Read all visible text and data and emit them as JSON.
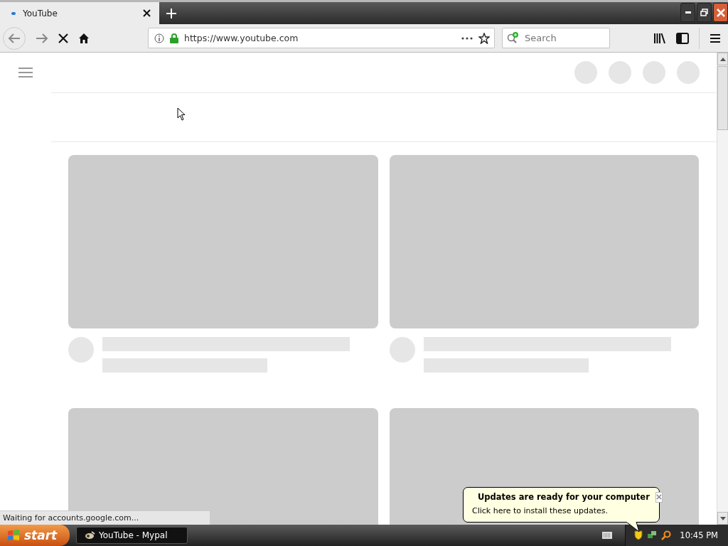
{
  "browser": {
    "tabs": [
      {
        "title": "YouTube",
        "selected": true
      }
    ],
    "address": "https://www.youtube.com",
    "search": {
      "placeholder": "Search"
    },
    "status": "Waiting for accounts.google.com..."
  },
  "page": {
    "cards": [
      {
        "kind": "skeleton"
      },
      {
        "kind": "skeleton"
      },
      {
        "kind": "thumbnail_only"
      },
      {
        "kind": "thumbnail_only"
      }
    ]
  },
  "taskbar": {
    "start": "start",
    "tasks": [
      {
        "label": "YouTube - Mypal",
        "selected": true
      }
    ],
    "clock": "10:45 PM"
  },
  "balloon": {
    "title": "Updates are ready for your computer",
    "text": "Click here to install these updates."
  }
}
